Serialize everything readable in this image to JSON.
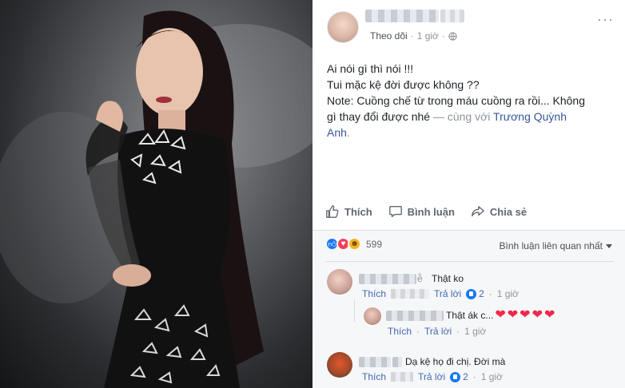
{
  "post": {
    "meta": {
      "follow_label": "Theo dõi",
      "separator": "·",
      "time": "1 giờ",
      "audience_icon": "globe-icon"
    },
    "text_lines": [
      "Ai nói gì thì nói !!!",
      "Tui mặc kệ đời được không ??",
      "Note: Cuồng chế từ trong máu cuồng ra rồi... Không",
      "gì thay đổi được nhé"
    ],
    "with_prefix": " — cùng với ",
    "tagged_person": "Trương Quỳnh",
    "tagged_person_2": "Anh",
    "trailing_period": "."
  },
  "actions": {
    "like": "Thích",
    "comment": "Bình luận",
    "share": "Chia sẻ"
  },
  "reactions": {
    "count": "599",
    "types": [
      "like",
      "love",
      "haha"
    ],
    "colors": {
      "like": "#1877f2",
      "love": "#f33e58",
      "haha": "#f7b125"
    }
  },
  "sort_label": "Bình luận liên quan nhất",
  "comments": [
    {
      "name_visible": "ễ",
      "text": "Thật ko",
      "like": "Thích",
      "reply": "Trả lời",
      "reply_count": "2",
      "separator": "·",
      "time": "1 giờ"
    },
    {
      "text": "Thật ák c...",
      "hearts": 5,
      "like": "Thích",
      "reply": "Trả lời",
      "separator": "·",
      "time": "1 giờ"
    },
    {
      "text": "Dạ kệ họ đi chị. Đời mà",
      "like": "Thích",
      "reply": "Trả lời",
      "reply_count": "2",
      "separator": "·",
      "time": "1 giờ"
    }
  ],
  "more_icon": "more-dots-icon"
}
